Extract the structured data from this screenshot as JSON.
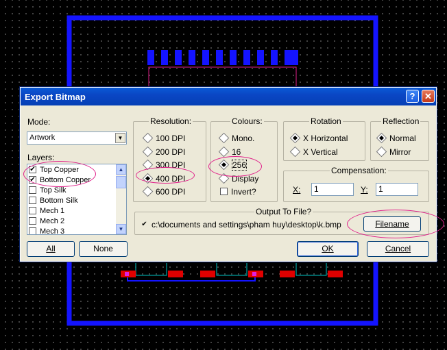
{
  "dialog": {
    "title": "Export Bitmap",
    "help_label": "?",
    "close_label": "✕"
  },
  "mode": {
    "label": "Mode:",
    "selected": "Artwork"
  },
  "layers": {
    "label": "Layers:",
    "items": [
      {
        "label": "Top Copper",
        "checked": true
      },
      {
        "label": "Bottom Copper",
        "checked": true
      },
      {
        "label": "Top Silk",
        "checked": false
      },
      {
        "label": "Bottom Silk",
        "checked": false
      },
      {
        "label": "Mech 1",
        "checked": false
      },
      {
        "label": "Mech 2",
        "checked": false
      },
      {
        "label": "Mech 3",
        "checked": false
      }
    ],
    "all_label": "All",
    "none_label": "None"
  },
  "resolution": {
    "title": "Resolution:",
    "options": [
      "100 DPI",
      "200 DPI",
      "300 DPI",
      "400 DPI",
      "600 DPI"
    ],
    "selected": "400 DPI"
  },
  "colours": {
    "title": "Colours:",
    "options": [
      "Mono.",
      "16",
      "256",
      "Display"
    ],
    "selected": "256",
    "invert_label": "Invert?"
  },
  "rotation": {
    "title": "Rotation",
    "options": [
      "X Horizontal",
      "X Vertical"
    ],
    "selected": "X Horizontal"
  },
  "reflection": {
    "title": "Reflection",
    "options": [
      "Normal",
      "Mirror"
    ],
    "selected": "Normal"
  },
  "compensation": {
    "title": "Compensation:",
    "x_label": "X:",
    "x_value": "1",
    "y_label": "Y:",
    "y_value": "1"
  },
  "output": {
    "title": "Output To File?",
    "checked": true,
    "path": "c:\\documents and settings\\pham huy\\desktop\\k.bmp",
    "filename_label": "Filename"
  },
  "ok_label": "OK",
  "cancel_label": "Cancel",
  "colors": {
    "board_outline": "#1414ff",
    "pad": "#e00000",
    "track_cyan": "#00c8c8",
    "annotation": "#e0208a",
    "titlebar": "#0a46c4"
  }
}
